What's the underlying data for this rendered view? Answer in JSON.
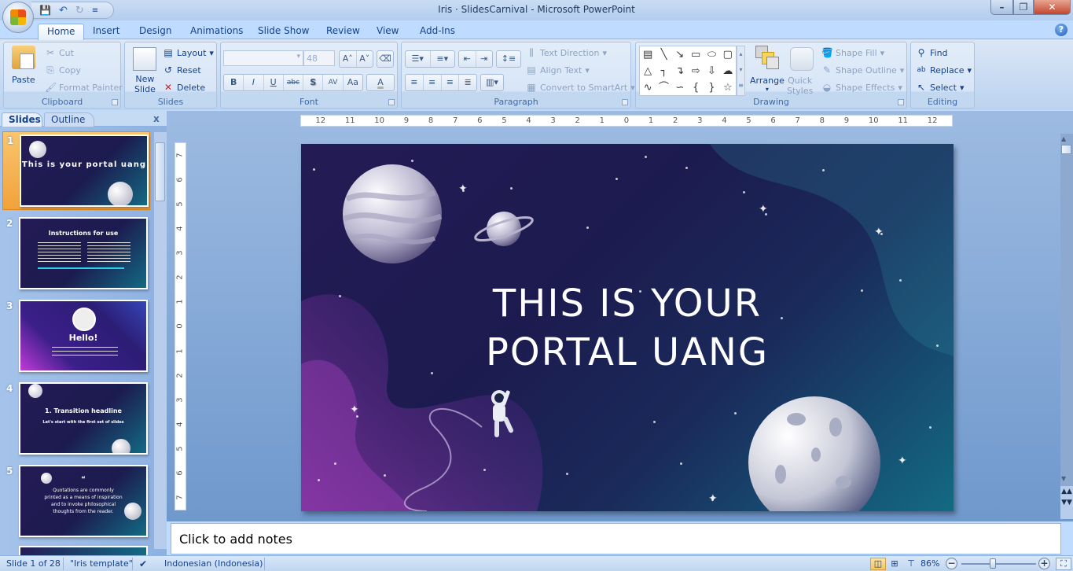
{
  "window": {
    "title": "Iris · SlidesCarnival  -  Microsoft PowerPoint",
    "controls": {
      "minimize": "–",
      "maximize": "❐",
      "close": "✕"
    }
  },
  "quick_access": {
    "save": "💾",
    "undo": "↶",
    "undo_dropdown": "▾",
    "redo": "↻",
    "customize": "≡"
  },
  "tabs": [
    {
      "label": "Home",
      "active": true
    },
    {
      "label": "Insert"
    },
    {
      "label": "Design"
    },
    {
      "label": "Animations"
    },
    {
      "label": "Slide Show"
    },
    {
      "label": "Review"
    },
    {
      "label": "View"
    },
    {
      "label": "Add-Ins"
    }
  ],
  "help_icon": "?",
  "ribbon": {
    "clipboard": {
      "label": "Clipboard",
      "paste": "Paste",
      "cut": "Cut",
      "copy": "Copy",
      "format_painter": "Format Painter"
    },
    "slides": {
      "label": "Slides",
      "new_slide_line1": "New",
      "new_slide_line2": "Slide",
      "layout": "Layout",
      "reset": "Reset",
      "delete": "Delete"
    },
    "font": {
      "label": "Font",
      "font_name": "",
      "font_size": "48",
      "grow": "A˄",
      "shrink": "A˅",
      "clear": "A̲",
      "bold": "B",
      "italic": "I",
      "underline": "U",
      "strike": "abc",
      "shadow": "S",
      "spacing": "AV",
      "case": "Aa",
      "color": "A"
    },
    "paragraph": {
      "label": "Paragraph",
      "text_direction": "Text Direction",
      "align_text": "Align Text",
      "convert_smartart": "Convert to SmartArt"
    },
    "drawing": {
      "label": "Drawing",
      "arrange": "Arrange",
      "quick_styles_line1": "Quick",
      "quick_styles_line2": "Styles",
      "shape_fill": "Shape Fill",
      "shape_outline": "Shape Outline",
      "shape_effects": "Shape Effects",
      "shapes": [
        "▤",
        "╲",
        "↘",
        "▭",
        "⬭",
        "▢",
        "△",
        "┐",
        "↴",
        "⇨",
        "⇩",
        "☁",
        "∿",
        "⌒",
        "∽",
        "{",
        "}",
        "☆"
      ]
    },
    "editing": {
      "label": "Editing",
      "find": "Find",
      "replace": "Replace",
      "select": "Select"
    }
  },
  "left_pane": {
    "tab_slides": "Slides",
    "tab_outline": "Outline",
    "close": "x",
    "thumbnails": [
      {
        "number": "1",
        "title": "This is your portal uang",
        "selected": true
      },
      {
        "number": "2",
        "title": "Instructions for use"
      },
      {
        "number": "3",
        "title": "Hello!"
      },
      {
        "number": "4",
        "title": "1. Transition headline",
        "subtitle": "Let's start with the first set of slides"
      },
      {
        "number": "5",
        "title": "“",
        "subtitle": "Quotations are commonly printed as a means of inspiration and to invoke philosophical thoughts from the reader."
      }
    ]
  },
  "rulers": {
    "horizontal": [
      "12",
      "11",
      "10",
      "9",
      "8",
      "7",
      "6",
      "5",
      "4",
      "3",
      "2",
      "1",
      "0",
      "1",
      "2",
      "3",
      "4",
      "5",
      "6",
      "7",
      "8",
      "9",
      "10",
      "11",
      "12"
    ],
    "vertical": [
      "7",
      "6",
      "5",
      "4",
      "3",
      "2",
      "1",
      "0",
      "1",
      "2",
      "3",
      "4",
      "5",
      "6",
      "7"
    ]
  },
  "slide": {
    "title_line1": "THIS IS YOUR",
    "title_line2": "PORTAL UANG",
    "colors": {
      "bg_purple": "#241b55",
      "bg_navy": "#1c1b4f",
      "bg_teal": "#136a83",
      "accent_purple": "#8a35a6"
    }
  },
  "notes": {
    "placeholder": "Click to add notes"
  },
  "status_bar": {
    "slide_info": "Slide 1 of 28",
    "theme": "\"Iris template\"",
    "language": "Indonesian (Indonesia)",
    "zoom": "86%",
    "zoom_value_percent": 86
  }
}
